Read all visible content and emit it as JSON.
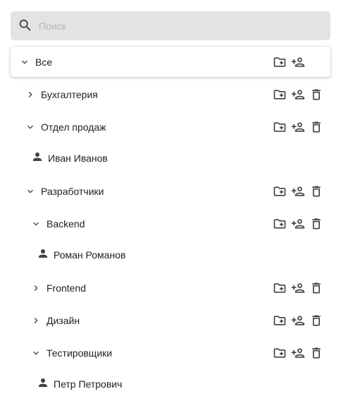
{
  "search": {
    "placeholder": "Поиск",
    "value": ""
  },
  "tree": [
    {
      "type": "group",
      "label": "Все",
      "expanded": true,
      "root": true,
      "deletable": false
    },
    {
      "type": "group",
      "label": "Бухгалтерия",
      "expanded": false,
      "deletable": true
    },
    {
      "type": "group",
      "label": "Отдел продаж",
      "expanded": true,
      "deletable": true
    },
    {
      "type": "user",
      "label": "Иван Иванов"
    },
    {
      "type": "group",
      "label": "Разработчики",
      "expanded": true,
      "deletable": true
    },
    {
      "type": "group",
      "label": "Backend",
      "expanded": true,
      "deletable": true
    },
    {
      "type": "user",
      "label": "Роман Романов"
    },
    {
      "type": "group",
      "label": "Frontend",
      "expanded": false,
      "deletable": true
    },
    {
      "type": "group",
      "label": "Дизайн",
      "expanded": false,
      "deletable": true
    },
    {
      "type": "group",
      "label": "Тестировщики",
      "expanded": true,
      "deletable": true
    },
    {
      "type": "user",
      "label": "Петр Петрович"
    }
  ],
  "colors": {
    "icon": "#424242",
    "text": "#212121",
    "search_bg": "#e3e3e3",
    "placeholder": "#b6b6b6"
  },
  "icons": {
    "search": "search-icon",
    "expand": "chevron-down-icon",
    "collapse": "chevron-right-icon",
    "user": "person-icon",
    "add_folder": "create-new-folder-icon",
    "add_user": "person-add-icon",
    "delete": "delete-icon"
  }
}
